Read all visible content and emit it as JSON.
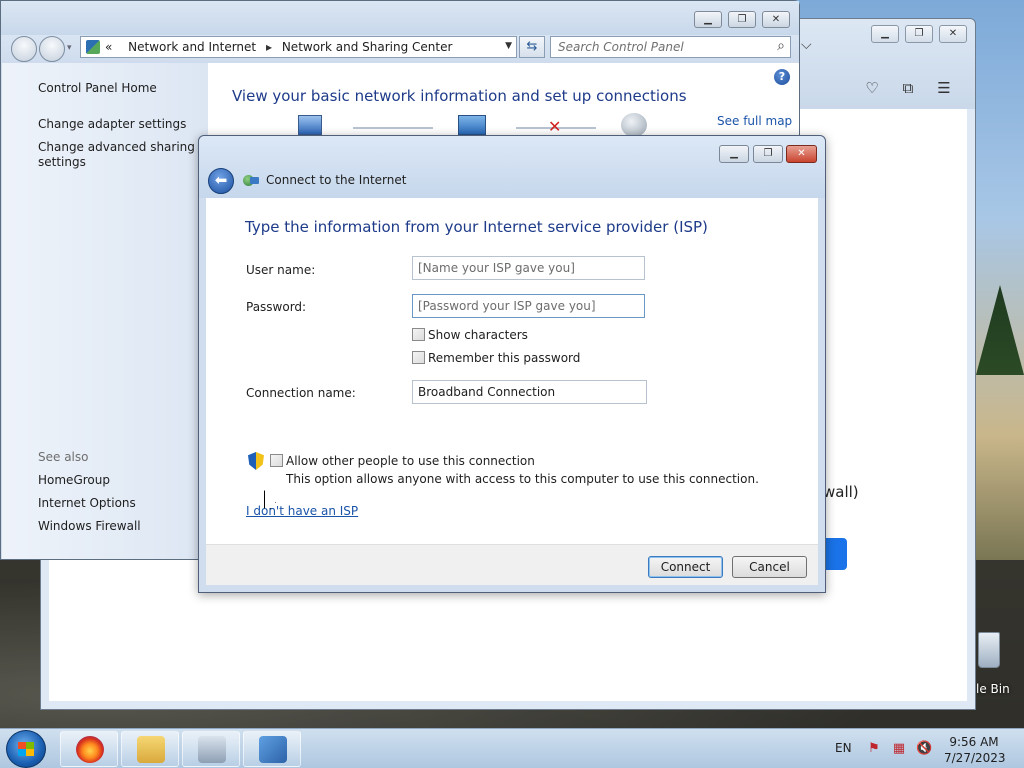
{
  "background_window": {
    "partial_text": "wall)"
  },
  "control_panel": {
    "breadcrumb": [
      "Network and Internet",
      "Network and Sharing Center"
    ],
    "breadcrumb_prefix": "«",
    "search_placeholder": "Search Control Panel",
    "left_nav": {
      "home": "Control Panel Home",
      "change_adapter": "Change adapter settings",
      "change_sharing_line1": "Change advanced sharing",
      "change_sharing_line2": "settings",
      "see_also": "See also",
      "homegroup": "HomeGroup",
      "internet_options": "Internet Options",
      "windows_firewall": "Windows Firewall"
    },
    "main": {
      "heading": "View your basic network information and set up connections",
      "full_map_link": "See full map",
      "help": "?"
    }
  },
  "dialog": {
    "title": "Connect to the Internet",
    "heading": "Type the information from your Internet service provider (ISP)",
    "user_name_label": "User name:",
    "user_name_placeholder": "[Name your ISP gave you]",
    "password_label": "Password:",
    "password_placeholder": "[Password your ISP gave you]",
    "show_characters": "Show characters",
    "remember_password": "Remember this password",
    "connection_name_label": "Connection name:",
    "connection_name_value": "Broadband Connection",
    "allow_others": "Allow other people to use this connection",
    "allow_note": "This option allows anyone with access to this computer to use this connection.",
    "no_isp_link": "I don't have an ISP",
    "connect_button": "Connect",
    "cancel_button": "Cancel",
    "checkboxes": {
      "show_characters": false,
      "remember_password": false,
      "allow_others": false
    }
  },
  "taskbar": {
    "language": "EN",
    "time": "9:56 AM",
    "date": "7/27/2023"
  },
  "desktop": {
    "recycle_bin_partial": "le Bin"
  },
  "colors": {
    "link": "#1a54a8",
    "heading": "#1e3b8a"
  }
}
